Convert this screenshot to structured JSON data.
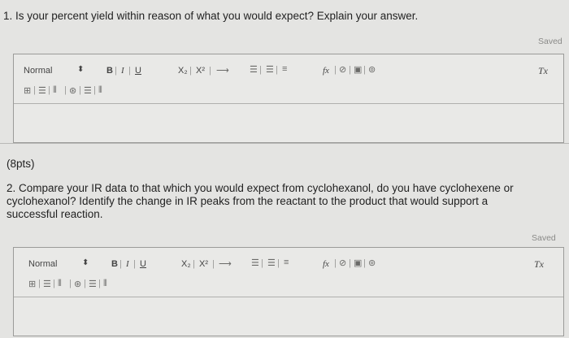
{
  "q1": {
    "text": "1. Is your percent yield within reason of what you would expect? Explain your answer.",
    "saved": "Saved"
  },
  "points": "(8pts)",
  "q2": {
    "text_line1": "2. Compare your IR data to that which you would expect from cyclohexanol, do you have cyclohexene or",
    "text_line2": "cyclohexanol? Identify the change in IR peaks from the reactant to the product that would support a",
    "text_line3": "successful reaction.",
    "saved": "Saved"
  },
  "toolbar": {
    "format_select": "Normal",
    "bold": "B",
    "italic": "I",
    "underline": "U",
    "subscript": "X₂",
    "superscript": "X²",
    "formula": "fx",
    "clear_format": "Tx"
  }
}
